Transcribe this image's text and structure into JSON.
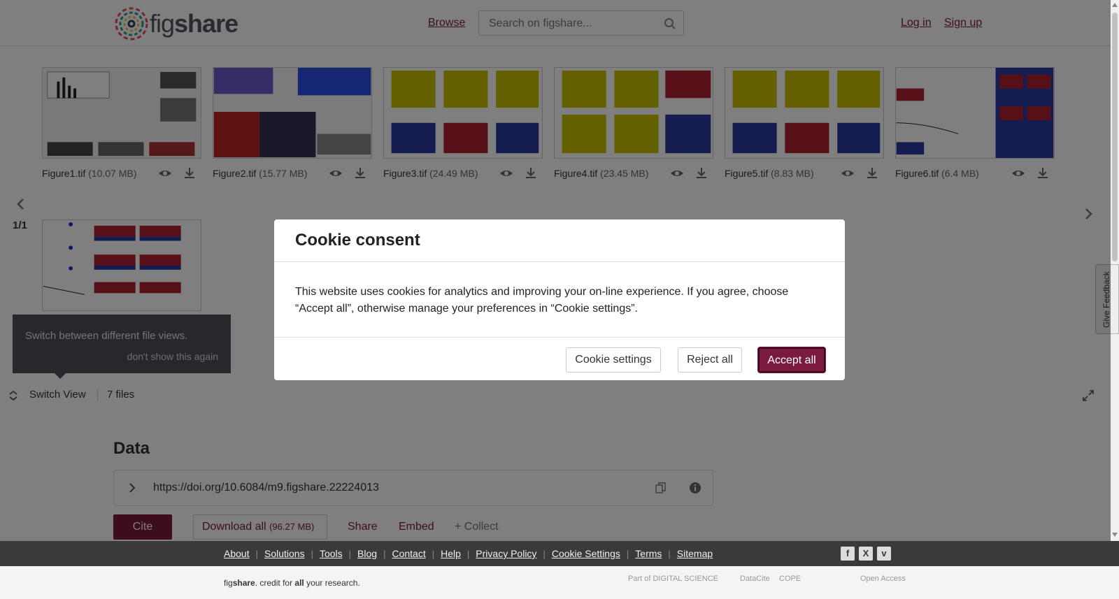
{
  "header": {
    "logo_text_fig": "fig",
    "logo_text_share": "share",
    "browse": "Browse",
    "search_placeholder": "Search on figshare...",
    "login": "Log in",
    "signup": "Sign up"
  },
  "gallery": {
    "files": [
      {
        "name": "Figure1.tif",
        "size": "(10.07 MB)"
      },
      {
        "name": "Figure2.tif",
        "size": "(15.77 MB)"
      },
      {
        "name": "Figure3.tif",
        "size": "(24.49 MB)"
      },
      {
        "name": "Figure4.tif",
        "size": "(23.45 MB)"
      },
      {
        "name": "Figure5.tif",
        "size": "(8.83 MB)"
      },
      {
        "name": "Figure6.tif",
        "size": "(6.4 MB)"
      }
    ],
    "page": "1/1",
    "tooltip_text": "Switch between different file views.",
    "tooltip_dismiss": "don't show this again",
    "switch_view": "Switch View",
    "files_count": "7 files"
  },
  "content": {
    "section_title": "Data",
    "doi": "https://doi.org/10.6084/m9.figshare.22224013",
    "cite": "Cite",
    "download_all": "Download all",
    "download_all_size": "(96.27 MB)",
    "share": "Share",
    "embed": "Embed",
    "collect": "+ Collect"
  },
  "footer": {
    "links": [
      "About",
      "Solutions",
      "Tools",
      "Blog",
      "Contact",
      "Help",
      "Privacy Policy",
      "Cookie Settings",
      "Terms",
      "Sitemap"
    ],
    "tagline_fig": "fig",
    "tagline_share": "share",
    "tagline_mid": ". credit for ",
    "tagline_all": "all",
    "tagline_end": " your research.",
    "partners": [
      "Part of DIGITAL SCIENCE",
      "DataCite",
      "COPE",
      "Open Access"
    ]
  },
  "feedback": "Give Feedback",
  "cookie_modal": {
    "title": "Cookie consent",
    "body": "This website uses cookies for analytics and improving your on-line experience. If you agree, choose “Accept all”, otherwise manage your preferences in “Cookie settings”.",
    "settings": "Cookie settings",
    "reject": "Reject all",
    "accept": "Accept all"
  },
  "colors": {
    "brand": "#7a1a3e",
    "footer_dark": "#3a3a3a",
    "tooltip_bg": "#4d5158"
  }
}
